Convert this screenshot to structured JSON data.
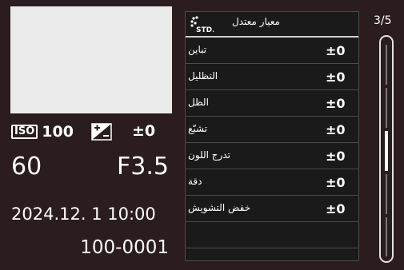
{
  "exposure": {
    "iso_badge": "ISO",
    "iso_value": "100",
    "ev_value": "±0",
    "shutter": "60",
    "aperture": "F3.5"
  },
  "datetime": "2024.12.  1 10:00",
  "file_number": "100-0001",
  "menu": {
    "header_icon": "STD.",
    "title": "معيار معتدل",
    "rows": [
      {
        "label": "تباين",
        "value": "±0"
      },
      {
        "label": "التظليل",
        "value": "±0"
      },
      {
        "label": "الظل",
        "value": "±0"
      },
      {
        "label": "تشبّع",
        "value": "±0"
      },
      {
        "label": "تدرج اللون",
        "value": "±0"
      },
      {
        "label": "دقة",
        "value": "±0"
      },
      {
        "label": "خفض التشويش",
        "value": "±0"
      }
    ]
  },
  "page_indicator": "3/5",
  "scroll": {
    "position": 3,
    "total": 5
  },
  "colors": {
    "background": "#2b1d1f",
    "preview": "#ebebeb",
    "menu_bg": "#1a1a1a",
    "text": "#ffffff"
  }
}
